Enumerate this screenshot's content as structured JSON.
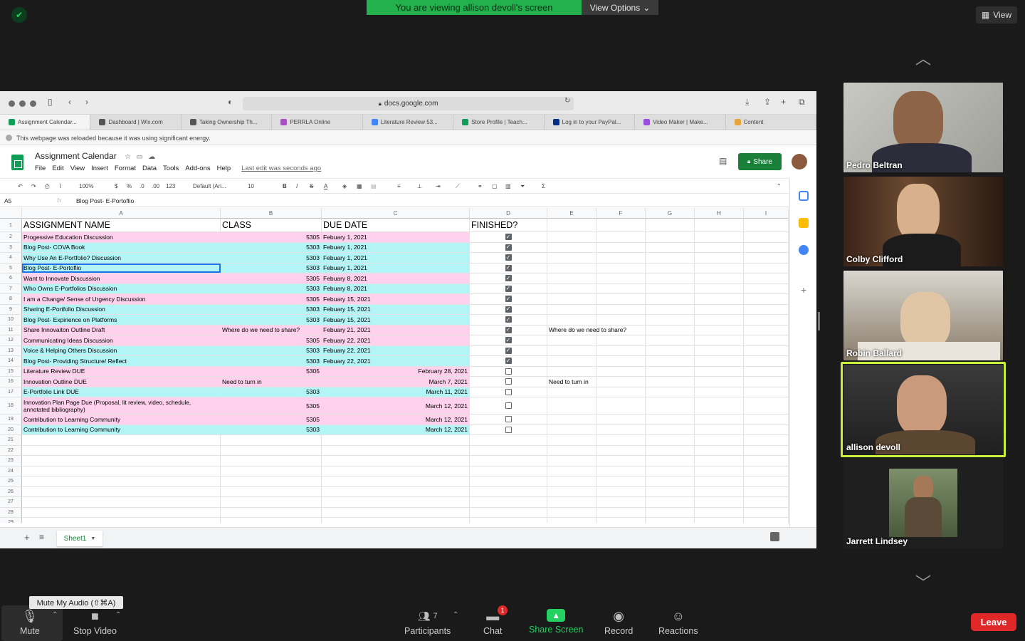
{
  "zoom": {
    "banner": "You are viewing allison devoll's screen",
    "view_options": "View Options",
    "view": "View",
    "tooltip": "Mute My Audio (⇧⌘A)",
    "participants_count": "7",
    "chat_badge": "1",
    "buttons": {
      "mute": "Mute",
      "stop_video": "Stop Video",
      "participants": "Participants",
      "chat": "Chat",
      "share_screen": "Share Screen",
      "record": "Record",
      "reactions": "Reactions",
      "leave": "Leave"
    },
    "gallery": [
      {
        "name": "Pedro Beltran"
      },
      {
        "name": "Colby Clifford"
      },
      {
        "name": "Robin Ballard"
      },
      {
        "name": "allison devoll"
      },
      {
        "name": "Jarrett Lindsey"
      }
    ],
    "colors": {
      "banner": "#23b14d",
      "active_speaker": "#c8f03c",
      "leave": "#e02828",
      "share_screen": "#23d160"
    }
  },
  "browser": {
    "url": "docs.google.com",
    "tabs": [
      {
        "label": "Assignment Calendar...",
        "color": "#0f9d58"
      },
      {
        "label": "Dashboard | Wix.com",
        "color": "#555555"
      },
      {
        "label": "Taking Ownership Th...",
        "color": "#555555"
      },
      {
        "label": "PERRLA Online",
        "color": "#a94fc2"
      },
      {
        "label": "Literature Review 53...",
        "color": "#4285f4"
      },
      {
        "label": "Store Profile | Teach...",
        "color": "#0f9d58"
      },
      {
        "label": "Log in to your PayPal...",
        "color": "#003087"
      },
      {
        "label": "Video Maker | Make...",
        "color": "#9b4fe0"
      },
      {
        "label": "Content",
        "color": "#e8a33d"
      }
    ],
    "notice": "This webpage was reloaded because it was using significant energy."
  },
  "sheets": {
    "title": "Assignment Calendar",
    "menu": [
      "File",
      "Edit",
      "View",
      "Insert",
      "Format",
      "Data",
      "Tools",
      "Add-ons",
      "Help"
    ],
    "last_edit": "Last edit was seconds ago",
    "share": "Share",
    "toolbar": {
      "zoom": "100%",
      "currency": "$",
      "percent": "%",
      "dec_less": ".0",
      "dec_more": ".00",
      "more_formats": "123",
      "font": "Default (Ari...",
      "size": "10"
    },
    "cell_ref": "A5",
    "formula": "Blog Post- E-Portoflio",
    "sheet_tab": "Sheet1",
    "columns": [
      "A",
      "B",
      "C",
      "D",
      "E",
      "F",
      "G",
      "H",
      "I"
    ],
    "header": [
      "ASSIGNMENT NAME",
      "CLASS",
      "DUE DATE",
      "FINISHED?"
    ],
    "rows": [
      {
        "name": "Progessive Education Discussion",
        "class": "5305",
        "due": "Febuary 1, 2021",
        "done": true,
        "color": "pink"
      },
      {
        "name": "Blog Post- COVA Book",
        "class": "5303",
        "due": "Febuary 1, 2021",
        "done": true,
        "color": "cyan"
      },
      {
        "name": "Why Use An E-Portfolio? Discussion",
        "class": "5303",
        "due": "Febuary 1, 2021",
        "done": true,
        "color": "cyan"
      },
      {
        "name": "Blog Post- E-Portoflio",
        "class": "5303",
        "due": "Febuary 1, 2021",
        "done": true,
        "color": "cyan"
      },
      {
        "name": "Want to Innovate Discussion",
        "class": "5305",
        "due": "Febuary 8, 2021",
        "done": true,
        "color": "pink"
      },
      {
        "name": "Who Owns E-Portfolios Discussion",
        "class": "5303",
        "due": "Febuary 8, 2021",
        "done": true,
        "color": "cyan"
      },
      {
        "name": "I am a Change/ Sense of Urgency Discussion",
        "class": "5305",
        "due": "Febuary 15, 2021",
        "done": true,
        "color": "pink"
      },
      {
        "name": "Sharing E-Portfolio Discussion",
        "class": "5303",
        "due": "Febuary 15, 2021",
        "done": true,
        "color": "cyan"
      },
      {
        "name": "Blog Post- Expirience on Platforms",
        "class": "5303",
        "due": "Febuary 15, 2021",
        "done": true,
        "color": "cyan"
      },
      {
        "name": "Share Innovaiton Outline Draft",
        "class": "Where do we need to share?",
        "due": "Febuary 21, 2021",
        "done": true,
        "color": "pink",
        "note": "Where do we need to share?"
      },
      {
        "name": "Communicating Ideas Discussion",
        "class": "5305",
        "due": "Febuary 22, 2021",
        "done": true,
        "color": "pink"
      },
      {
        "name": "Voice & Helping Others Discussion",
        "class": "5303",
        "due": "Febuary 22, 2021",
        "done": true,
        "color": "cyan"
      },
      {
        "name": "Blog Post- Providing Structure/ Reflect",
        "class": "5303",
        "due": "Febuary 22, 2021",
        "done": true,
        "color": "cyan"
      },
      {
        "name": "Literature Review DUE",
        "class": "5305",
        "due": "February 28, 2021",
        "done": false,
        "color": "pink"
      },
      {
        "name": "Innovation Outline DUE",
        "class": "Need to turn in",
        "due": "March 7, 2021",
        "done": false,
        "color": "pink",
        "note": "Need to turn in"
      },
      {
        "name": "E-Portfolio Link DUE",
        "class": "5303",
        "due": "March 11, 2021",
        "done": false,
        "color": "cyan"
      },
      {
        "name": "Innovation Plan Page Due (Proposal, lit review, video, schedule, annotated bibliography)",
        "class": "5305",
        "due": "March 12, 2021",
        "done": false,
        "color": "pink",
        "tall": true
      },
      {
        "name": "Contribution to Learning Community",
        "class": "5305",
        "due": "March 12, 2021",
        "done": false,
        "color": "pink"
      },
      {
        "name": "Contribution to Learning Community",
        "class": "5303",
        "due": "March 12, 2021",
        "done": false,
        "color": "cyan"
      }
    ],
    "empty_rows": [
      "21",
      "22",
      "23",
      "24",
      "25",
      "26",
      "27",
      "28",
      "29"
    ]
  }
}
